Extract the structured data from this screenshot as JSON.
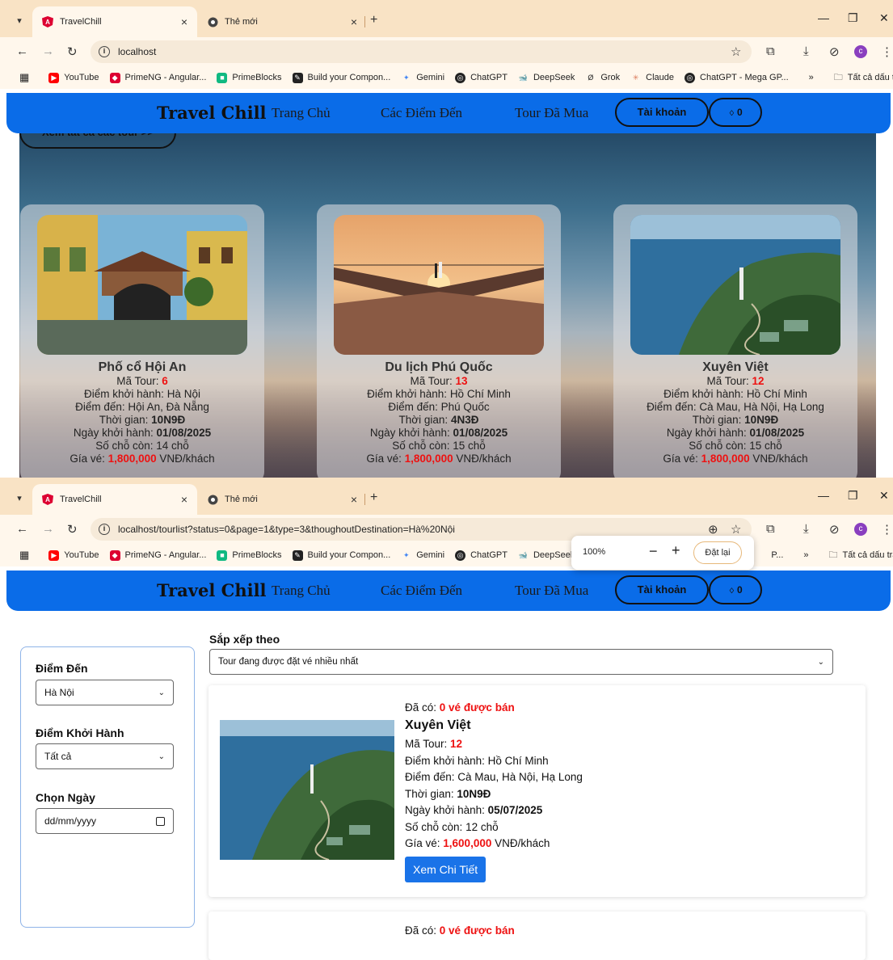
{
  "browser": {
    "tabs": [
      {
        "title": "TravelChill",
        "active": true
      },
      {
        "title": "Thẻ mới",
        "active": false
      }
    ],
    "frame1_url": "localhost",
    "frame2_url": "localhost/tourlist?status=0&page=1&type=3&thoughoutDestination=Hà%20Nội",
    "avatar_letter": "c",
    "bookmarks": [
      "YouTube",
      "PrimeNG - Angular...",
      "PrimeBlocks",
      "Build your Compon...",
      "Gemini",
      "ChatGPT",
      "DeepSeek",
      "Grok",
      "Claude",
      "ChatGPT - Mega GP..."
    ],
    "bookmarks_frame2": [
      "YouTube",
      "PrimeNG - Angular...",
      "PrimeBlocks",
      "Build your Compon...",
      "Gemini",
      "ChatGPT",
      "DeepSeek"
    ],
    "bookmarks_frame2_tail": "P...",
    "more_bookmarks": "»",
    "all_bookmarks": "Tất cả dấu trang"
  },
  "zoom_popup": {
    "percent": "100%",
    "minus": "−",
    "plus": "+",
    "reset": "Đặt lại"
  },
  "site": {
    "brand": "Travel Chill",
    "nav": [
      "Trang Chủ",
      "Các Điểm Đến",
      "Tour Đã Mua"
    ],
    "account_btn": "Tài khoản",
    "cart_btn": "0",
    "view_all": "Xem tất cả các tour >>"
  },
  "labels": {
    "code": "Mã Tour: ",
    "from": "Điểm khởi hành: ",
    "to": "Điểm đến: ",
    "time": "Thời gian: ",
    "start": "Ngày khởi hành: ",
    "seats": "Số chỗ còn: ",
    "seats_unit": " chỗ",
    "price": "Gía vé: ",
    "price_unit": " VNĐ/khách",
    "sold_prefix": "Đã có: ",
    "sold_suffix": " vé được bán"
  },
  "featured_tours": [
    {
      "title": "Phố cổ Hội An",
      "code": "6",
      "from": "Hà Nội",
      "to": "Hội An, Đà Nẵng",
      "time": "10N9Đ",
      "start": "01/08/2025",
      "seats": "14",
      "price": "1,800,000"
    },
    {
      "title": "Du lịch Phú Quốc",
      "code": "13",
      "from": "Hồ Chí Minh",
      "to": "Phú Quốc",
      "time": "4N3Đ",
      "start": "01/08/2025",
      "seats": "15",
      "price": "1,800,000"
    },
    {
      "title": "Xuyên Việt",
      "code": "12",
      "from": "Hồ Chí Minh",
      "to": "Cà Mau, Hà Nội, Hạ Long",
      "time": "10N9Đ",
      "start": "01/08/2025",
      "seats": "15",
      "price": "1,800,000"
    }
  ],
  "filters": {
    "destination_label": "Điểm Đến",
    "destination_value": "Hà Nội",
    "departure_label": "Điểm Khởi Hành",
    "departure_value": "Tất cả",
    "date_label": "Chọn Ngày",
    "date_placeholder": "dd/mm/yyyy"
  },
  "sort": {
    "label": "Sắp xếp theo",
    "value": "Tour đang được đặt vé nhiều nhất"
  },
  "results": [
    {
      "sold": "0",
      "title": "Xuyên Việt",
      "code": "12",
      "from": "Hồ Chí Minh",
      "to": "Cà Mau, Hà Nội, Hạ Long",
      "time": "10N9Đ",
      "start": "05/07/2025",
      "seats": "12",
      "price": "1,600,000",
      "button": "Xem Chi Tiết"
    },
    {
      "sold": "0"
    }
  ],
  "colors": {
    "nav_blue": "#0a6ce8",
    "price_red": "#e11111",
    "button_blue": "#1a73e8",
    "tabbar": "#f9e3c5"
  }
}
